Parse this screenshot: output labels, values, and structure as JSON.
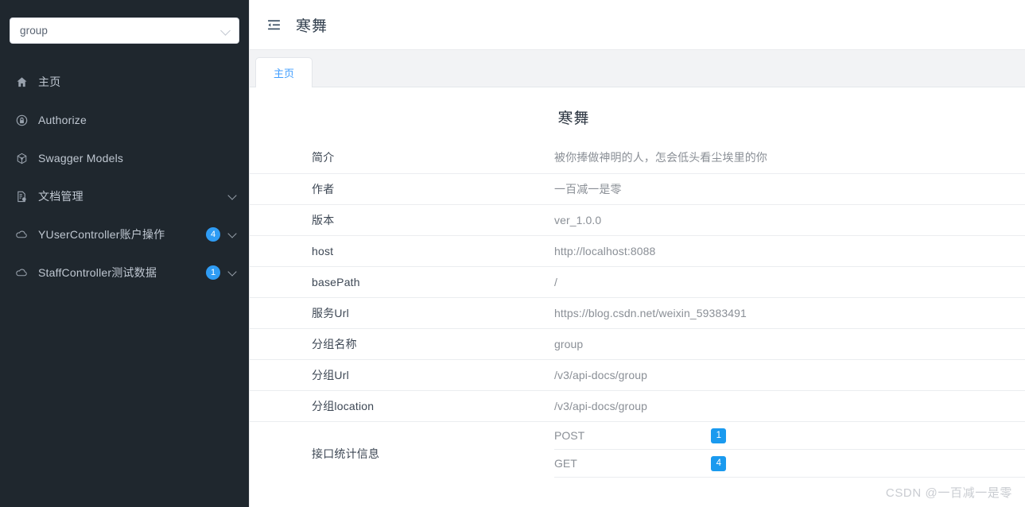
{
  "sidebar": {
    "group_select": {
      "value": "group",
      "icon": "chevron-down-icon"
    },
    "items": [
      {
        "label": "主页",
        "icon": "home-icon",
        "badge": null,
        "expandable": false
      },
      {
        "label": "Authorize",
        "icon": "lock-icon",
        "badge": null,
        "expandable": false
      },
      {
        "label": "Swagger Models",
        "icon": "cube-icon",
        "badge": null,
        "expandable": false
      },
      {
        "label": "文档管理",
        "icon": "document-gear-icon",
        "badge": null,
        "expandable": true
      },
      {
        "label": "YUserController账户操作",
        "icon": "cloud-icon",
        "badge": "4",
        "expandable": true
      },
      {
        "label": "StaffController测试数据",
        "icon": "cloud-icon",
        "badge": "1",
        "expandable": true
      }
    ]
  },
  "header": {
    "fold_icon": "menu-fold-icon",
    "title": "寒舞"
  },
  "tabs": [
    {
      "label": "主页",
      "active": true
    }
  ],
  "content": {
    "doc_title": "寒舞",
    "rows": [
      {
        "label": "简介",
        "value": "被你捧做神明的人，怎会低头看尘埃里的你"
      },
      {
        "label": "作者",
        "value": "一百减一是零"
      },
      {
        "label": "版本",
        "value": "ver_1.0.0"
      },
      {
        "label": "host",
        "value": "http://localhost:8088"
      },
      {
        "label": "basePath",
        "value": "/"
      },
      {
        "label": "服务Url",
        "value": "https://blog.csdn.net/weixin_59383491"
      },
      {
        "label": "分组名称",
        "value": "group"
      },
      {
        "label": "分组Url",
        "value": "/v3/api-docs/group"
      },
      {
        "label": "分组location",
        "value": "/v3/api-docs/group"
      }
    ],
    "stats": {
      "label": "接口统计信息",
      "entries": [
        {
          "method": "POST",
          "count": "1"
        },
        {
          "method": "GET",
          "count": "4"
        }
      ]
    }
  },
  "watermark": "CSDN @一百减一是零",
  "colors": {
    "sidebar_bg": "#1f272e",
    "accent_blue": "#409eff",
    "badge_round": "#2f9cf4",
    "badge_square": "#1a9aef"
  }
}
